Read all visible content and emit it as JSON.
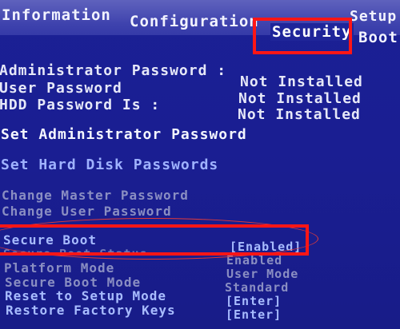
{
  "tabs": [
    {
      "label": "Information"
    },
    {
      "label": "Configuration"
    },
    {
      "label": "Security"
    },
    {
      "label": "Boot"
    },
    {
      "label": "Setup"
    }
  ],
  "passwords": [
    {
      "label": "Administrator Password :",
      "value": "Not Installed"
    },
    {
      "label": "User Password",
      "value": "Not Installed"
    },
    {
      "label": "HDD Password Is :",
      "value": "Not Installed"
    }
  ],
  "actions": {
    "set_admin_password": "Set Administrator Password",
    "set_hdd_passwords": "Set Hard Disk Passwords",
    "change_master_password": "Change Master Password",
    "change_user_password": "Change User Password"
  },
  "boot_settings": [
    {
      "label": "Secure Boot",
      "value": "[Enabled]"
    },
    {
      "label": "Secure Boot Status",
      "value": "Enabled"
    },
    {
      "label": "Platform Mode",
      "value": "User Mode"
    },
    {
      "label": "Secure Boot Mode",
      "value": "Standard"
    },
    {
      "label": "Reset to Setup Mode",
      "value": "[Enter]"
    },
    {
      "label": "Restore Factory Keys",
      "value": "[Enter]"
    }
  ],
  "colors": {
    "background": "#1d2196",
    "topbar": "#4b4fb5",
    "highlight_box": "#ff1616",
    "selectable_text": "#9fb2ff",
    "disabled_text": "#8a8ec2"
  }
}
